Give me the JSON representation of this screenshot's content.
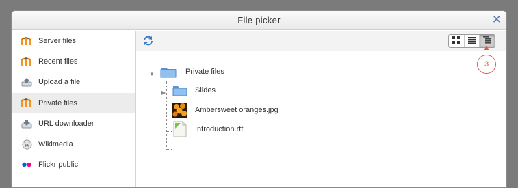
{
  "dialog": {
    "title": "File picker"
  },
  "sidebar": {
    "items": [
      {
        "label": "Server files",
        "icon": "moodle-icon"
      },
      {
        "label": "Recent files",
        "icon": "moodle-icon"
      },
      {
        "label": "Upload a file",
        "icon": "upload-icon"
      },
      {
        "label": "Private files",
        "icon": "moodle-icon",
        "active": true
      },
      {
        "label": "URL downloader",
        "icon": "url-download-icon"
      },
      {
        "label": "Wikimedia",
        "icon": "wikimedia-icon"
      },
      {
        "label": "Flickr public",
        "icon": "flickr-icon"
      }
    ]
  },
  "toolbar": {
    "views": [
      "icons",
      "details",
      "tree"
    ],
    "selected_view": "tree"
  },
  "callout": {
    "number": "3"
  },
  "tree": {
    "root": {
      "label": "Private files",
      "expanded": true
    },
    "children": [
      {
        "label": "Slides",
        "type": "folder",
        "expanded": false
      },
      {
        "label": "Ambersweet oranges.jpg",
        "type": "image"
      },
      {
        "label": "Introduction.rtf",
        "type": "document"
      }
    ]
  },
  "colors": {
    "accent": "#5a78b5",
    "callout": "#e25a4d",
    "folder": "#6fa3e0"
  }
}
